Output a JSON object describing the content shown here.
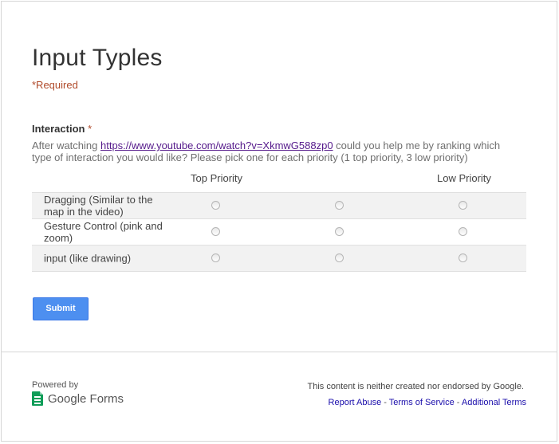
{
  "form": {
    "title": "Input Typles",
    "required_note": "*Required"
  },
  "question": {
    "title": "Interaction",
    "required_star": "*",
    "help_before": "After watching ",
    "help_link": "https://www.youtube.com/watch?v=XkmwG588zp0",
    "help_after": " could you help me by ranking which type of interaction you would like? Please pick one for each priority (1 top priority, 3 low priority)",
    "col_top": "Top Priority",
    "col_low": "Low Priority",
    "rows": [
      "Dragging (Similar to the map in the video)",
      "Gesture Control (pink and zoom)",
      "input (like drawing)"
    ]
  },
  "submit_label": "Submit",
  "footer": {
    "powered_by": "Powered by",
    "brand": "Google Forms",
    "disclaimer": "This content is neither created nor endorsed by Google.",
    "report_abuse": "Report Abuse",
    "sep": " - ",
    "terms": "Terms of Service",
    "additional_terms": "Additional Terms"
  },
  "colors": {
    "accent": "#4d8ff0",
    "required": "#b04a2a",
    "brand_green": "#0f9d58"
  }
}
